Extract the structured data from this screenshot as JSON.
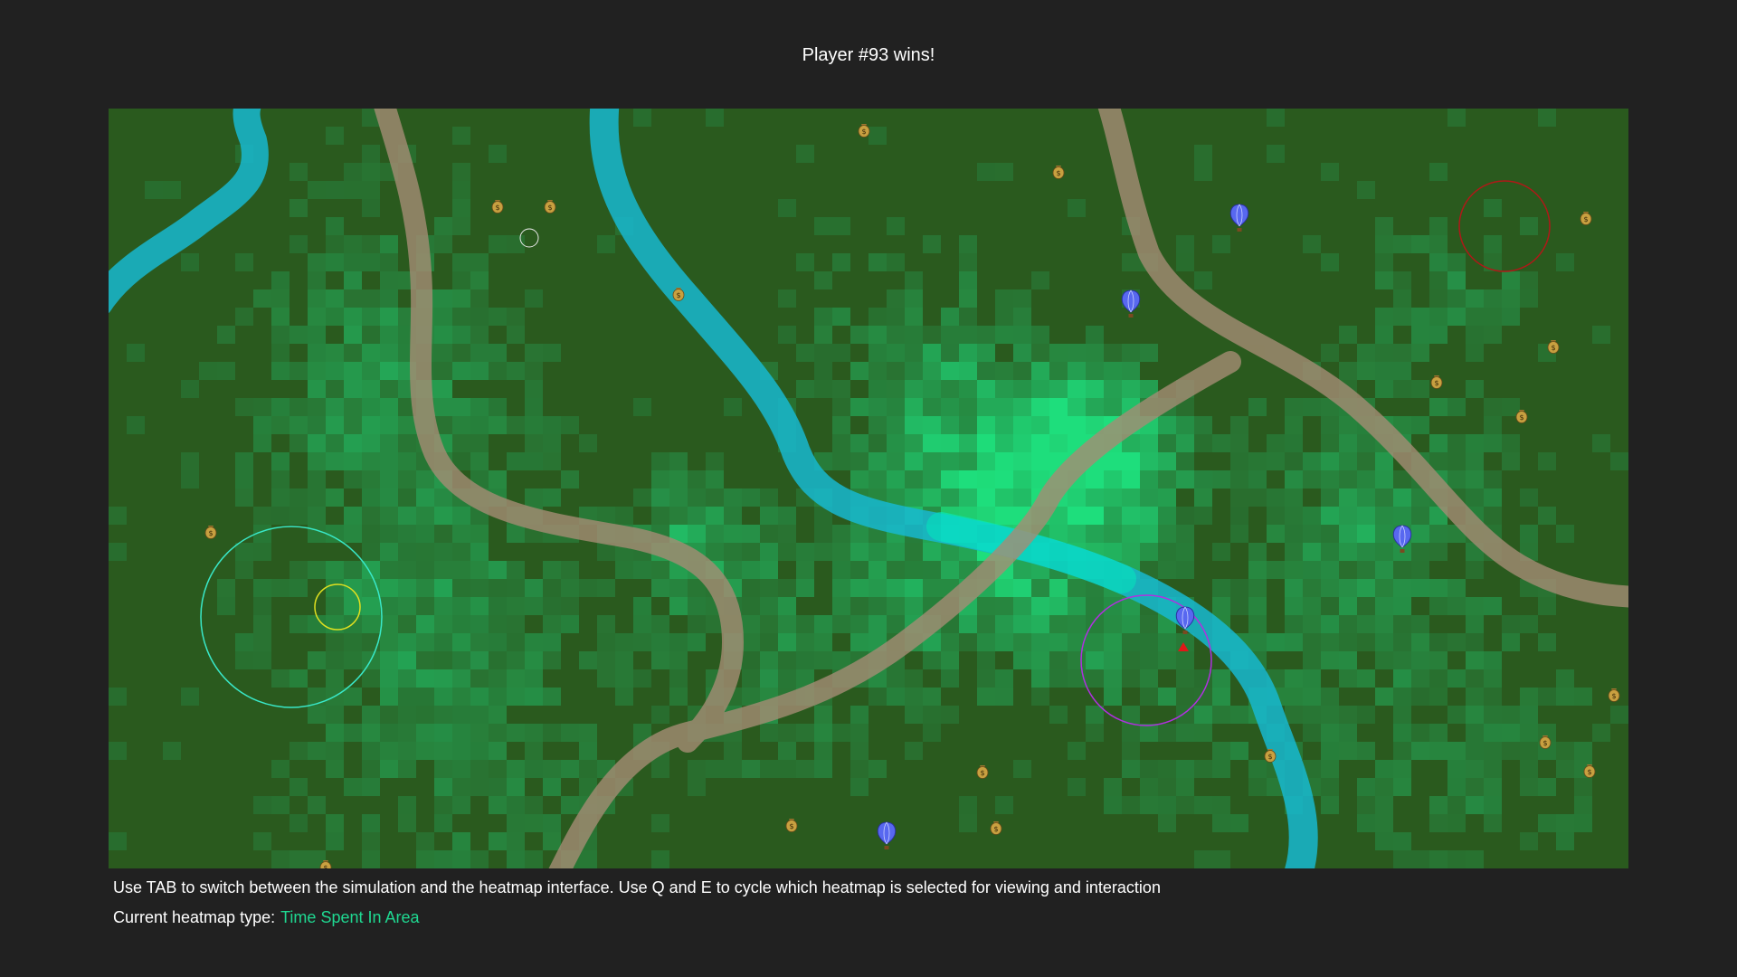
{
  "banner": {
    "text": "Player #93 wins!"
  },
  "footer": {
    "instructions": "Use TAB to switch between the simulation and the heatmap interface. Use Q and E to cycle which heatmap is selected for viewing and interaction",
    "heatmap_label": "Current heatmap type:",
    "heatmap_value": "Time Spent In Area"
  },
  "colors": {
    "background": "#212121",
    "terrain": "#2a5a1e",
    "heat_low": "#2f7a3a",
    "heat_high": "#1fe07a",
    "river": "#18b8d0",
    "river_hot": "#00f0d0",
    "road": "#9c8570",
    "heatmap_value_text": "#1fd891",
    "selection_ring": "#39e8c8",
    "player_ring": "#e0e020",
    "zone_red": "#b01818",
    "zone_purple": "#b030e0",
    "balloon": "#5868f0",
    "loot": "#c8a040"
  },
  "map": {
    "icons": {
      "balloon": "hot-air-balloon-icon",
      "loot": "money-bag-icon"
    },
    "balloon_count": 5,
    "loot_count": 18
  }
}
